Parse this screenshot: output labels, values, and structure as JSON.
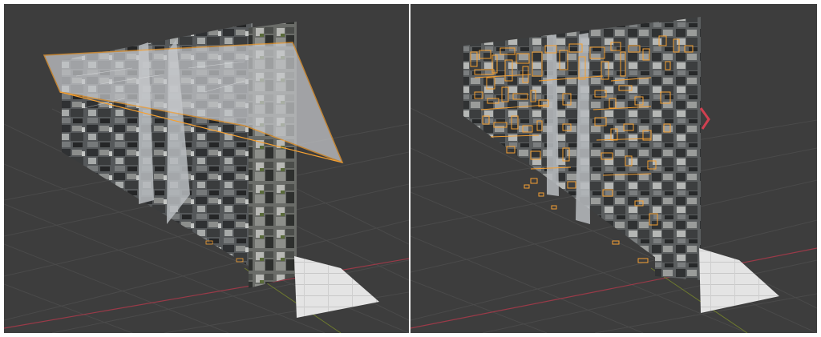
{
  "viewports": [
    {
      "id": "left",
      "description_free": true,
      "selection": "single-cutting-plane",
      "selection_color": "#f5a032"
    },
    {
      "id": "right",
      "selection": "decal-fragments",
      "selection_color": "#f5a032"
    }
  ],
  "colors": {
    "background": "#3d3d3d",
    "grid": "#4a4a4a",
    "x_axis": "#9a3a48",
    "y_axis": "#6e7a2e",
    "selection": "#f5a032",
    "plane_fill": "#b9bcc0",
    "stone_dark": "#2f3133",
    "stone_light": "#8c8e8c",
    "floor": "#e6e6e6"
  },
  "icons": [
    "gizmo-arrow-icon"
  ]
}
